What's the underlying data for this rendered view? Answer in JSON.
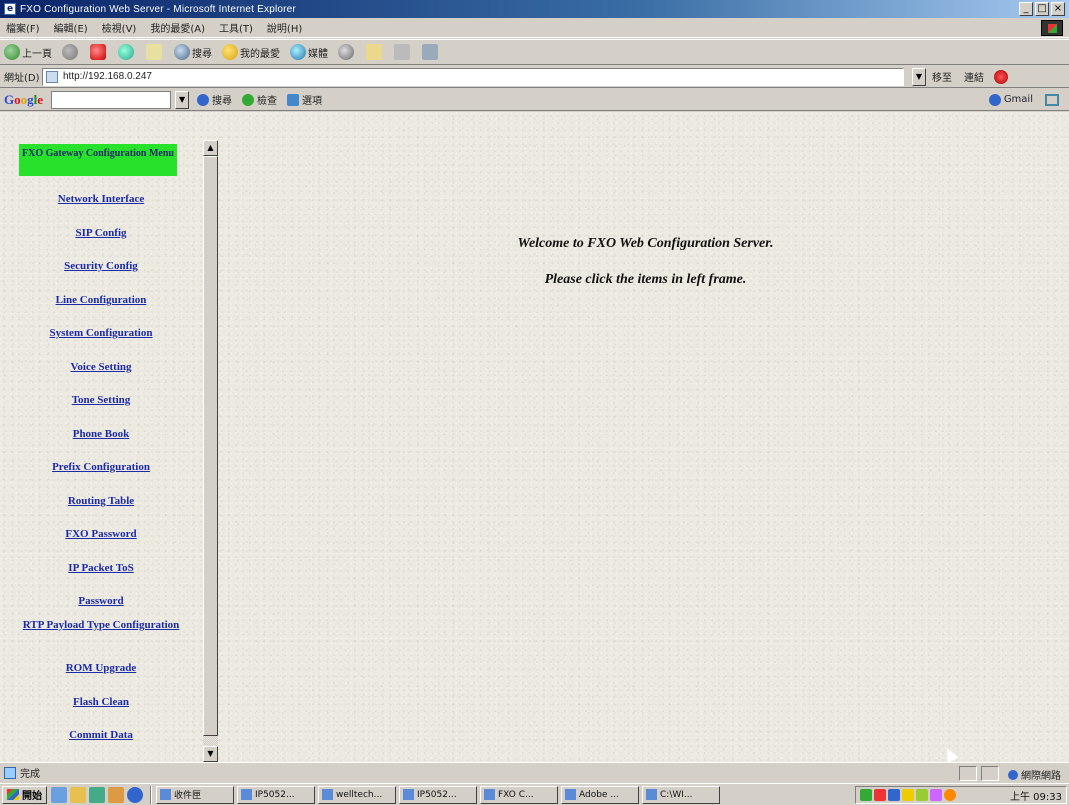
{
  "window": {
    "title": "FXO Configuration Web Server - Microsoft Internet Explorer",
    "controls": [
      "_",
      "□",
      "×"
    ]
  },
  "menubar": {
    "items": [
      "檔案(F)",
      "編輯(E)",
      "檢視(V)",
      "我的最愛(A)",
      "工具(T)",
      "說明(H)"
    ]
  },
  "toolbar": {
    "back_label": "上一頁",
    "search_label": "搜尋",
    "favorites_label": "我的最愛",
    "media_label": "媒體"
  },
  "address": {
    "label": "網址(D)",
    "value": "http://192.168.0.247",
    "go_label": "移至",
    "links_label": "連結"
  },
  "googlebar": {
    "logo": "Google",
    "search_label": "搜尋",
    "check_label": "檢查",
    "options_label": "選項",
    "right_label": "Gmail"
  },
  "nav": {
    "header": "FXO Gateway Configuration Menu",
    "links": [
      "Network Interface",
      "SIP Config",
      "Security Config",
      "Line Configuration",
      "System Configuration",
      "Voice Setting",
      "Tone Setting",
      "Phone Book",
      "Prefix Configuration",
      "Routing Table",
      "FXO Password",
      "IP Packet ToS",
      "Password",
      "RTP Payload Type Configuration",
      "ROM Upgrade",
      "Flash Clean",
      "Commit Data"
    ]
  },
  "main": {
    "welcome": "Welcome to FXO Web Configuration Server.",
    "instruction": "Please click the items in left frame."
  },
  "status": {
    "text": "完成",
    "zone": "網際網路"
  },
  "taskbar": {
    "start_label": "開始",
    "tasks": [
      "收件匣",
      "IP5052...",
      "welltech...",
      "IP5052...",
      "FXO C...",
      "Adobe ...",
      "C:\\WI..."
    ],
    "clock": "上午 09:33"
  }
}
